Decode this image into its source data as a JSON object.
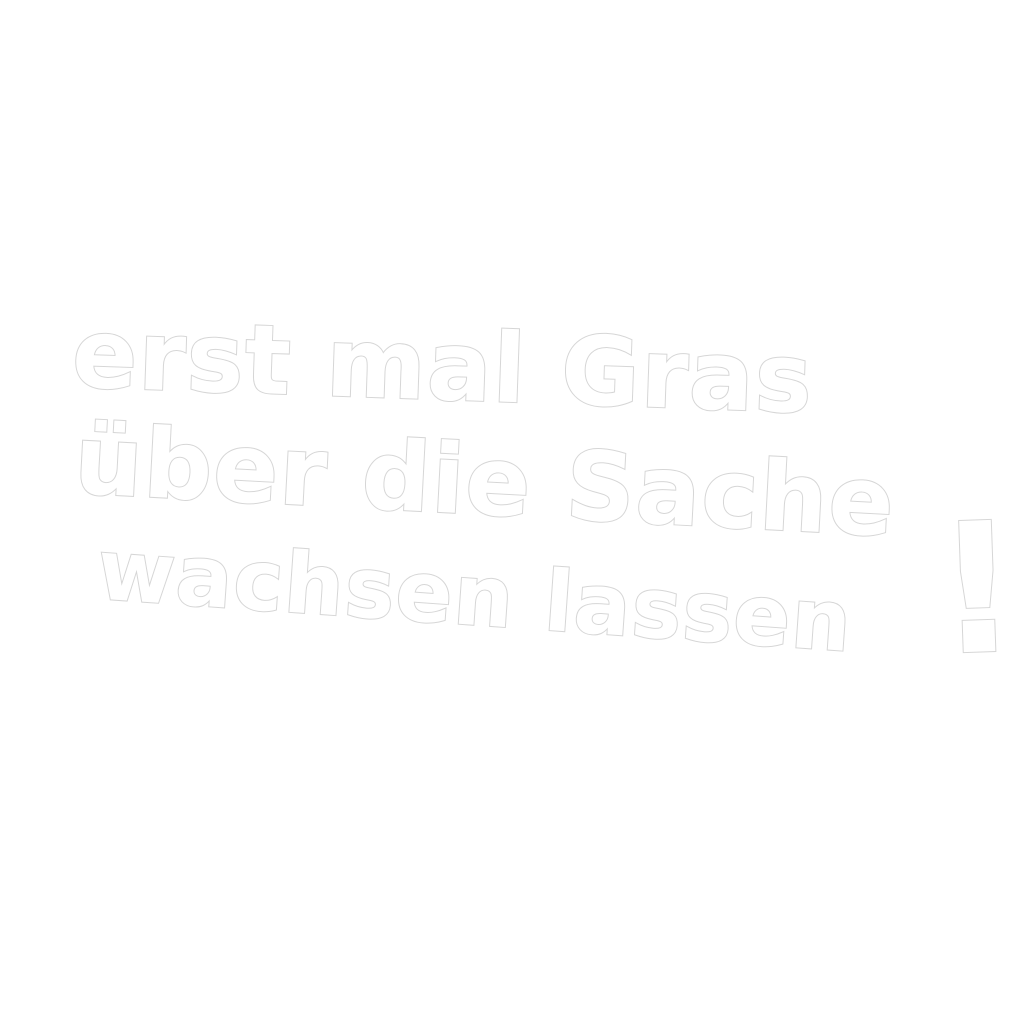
{
  "handwritten_text": {
    "line_1": "erst mal Gras",
    "line_2": "über die Sache",
    "line_3": "wachsen lassen",
    "exclamation": "!"
  },
  "colors": {
    "background": "#ffffff",
    "letter_fill": "#ffffff",
    "letter_outline": "#d6d6d6"
  }
}
